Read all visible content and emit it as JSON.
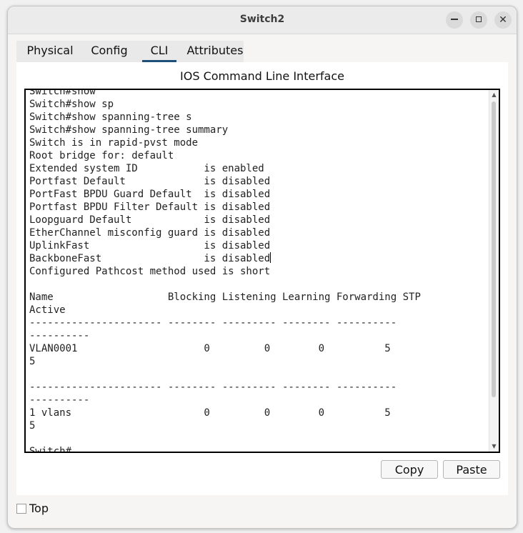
{
  "window": {
    "title": "Switch2",
    "controls": {
      "minimize_icon": "minimize-icon",
      "maximize_icon": "maximize-icon",
      "close_icon": "close-icon",
      "close_glyph": "✕"
    }
  },
  "tabs": [
    {
      "label": "Physical",
      "active": false
    },
    {
      "label": "Config",
      "active": false
    },
    {
      "label": "CLI",
      "active": true
    },
    {
      "label": "Attributes",
      "active": false
    }
  ],
  "cli": {
    "heading": "IOS Command Line Interface",
    "lines": [
      "Switch#show",
      "Switch#show sp",
      "Switch#show spanning-tree s",
      "Switch#show spanning-tree summary",
      "Switch is in rapid-pvst mode",
      "Root bridge for: default",
      "Extended system ID           is enabled",
      "Portfast Default             is disabled",
      "PortFast BPDU Guard Default  is disabled",
      "Portfast BPDU Filter Default is disabled",
      "Loopguard Default            is disabled",
      "EtherChannel misconfig guard is disabled",
      "UplinkFast                   is disabled",
      "BackboneFast                 is disabled",
      "Configured Pathcost method used is short",
      "",
      "Name                   Blocking Listening Learning Forwarding STP",
      "Active",
      "---------------------- -------- --------- -------- ----------",
      "----------",
      "VLAN0001                     0         0        0          5",
      "5",
      "",
      "---------------------- -------- --------- -------- ----------",
      "----------",
      "1 vlans                      0         0        0          5",
      "5",
      "",
      "Switch#"
    ]
  },
  "buttons": {
    "copy": "Copy",
    "paste": "Paste"
  },
  "footer": {
    "top_label": "Top",
    "top_checked": false
  },
  "scrollbar": {
    "up_glyph": "▲",
    "down_glyph": "▼"
  }
}
